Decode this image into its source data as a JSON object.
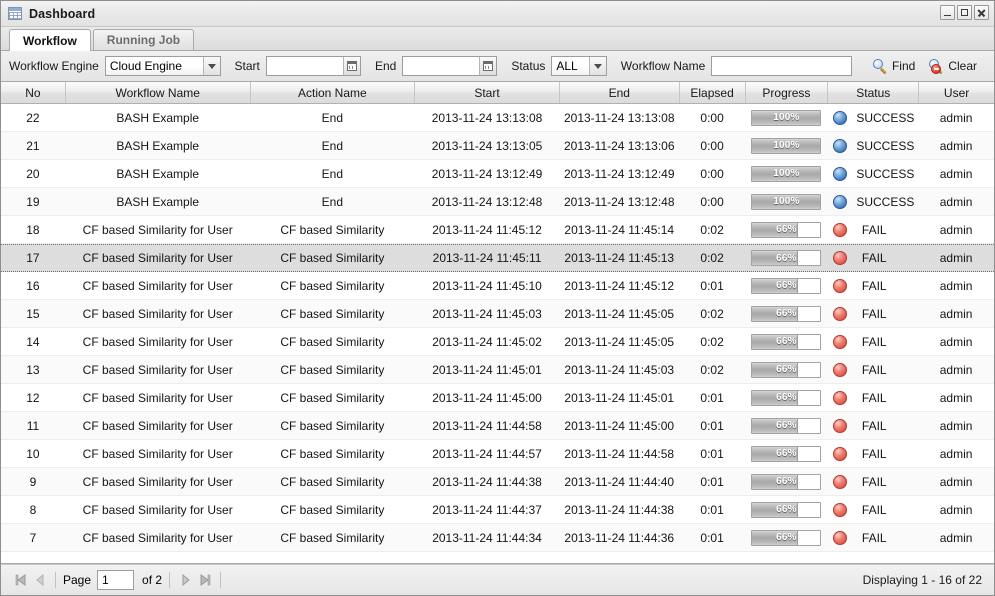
{
  "window": {
    "title": "Dashboard",
    "icon": "grid-icon",
    "controls": {
      "minimize": "minimize-icon",
      "maximize": "maximize-icon",
      "close": "close-icon"
    }
  },
  "tabs": [
    {
      "label": "Workflow",
      "active": true
    },
    {
      "label": "Running Job",
      "active": false
    }
  ],
  "filters": {
    "engine_label": "Workflow Engine",
    "engine_value": "Cloud Engine",
    "start_label": "Start",
    "start_value": "",
    "start_placeholder": "",
    "end_label": "End",
    "end_value": "",
    "end_placeholder": "",
    "status_label": "Status",
    "status_value": "ALL",
    "name_label": "Workflow Name",
    "name_value": "",
    "name_placeholder": "",
    "find_label": "Find",
    "clear_label": "Clear"
  },
  "grid": {
    "columns": [
      "No",
      "Workflow Name",
      "Action Name",
      "Start",
      "End",
      "Elapsed",
      "Progress",
      "Status",
      "User"
    ],
    "rows": [
      {
        "no": "22",
        "workflow": "BASH Example",
        "action": "End",
        "start": "2013-11-24 13:13:08",
        "end": "2013-11-24 13:13:08",
        "elapsed": "0:00",
        "progress": "100%",
        "progress_pct": 100,
        "status": "SUCCESS",
        "user": "admin",
        "selected": false
      },
      {
        "no": "21",
        "workflow": "BASH Example",
        "action": "End",
        "start": "2013-11-24 13:13:05",
        "end": "2013-11-24 13:13:06",
        "elapsed": "0:00",
        "progress": "100%",
        "progress_pct": 100,
        "status": "SUCCESS",
        "user": "admin",
        "selected": false
      },
      {
        "no": "20",
        "workflow": "BASH Example",
        "action": "End",
        "start": "2013-11-24 13:12:49",
        "end": "2013-11-24 13:12:49",
        "elapsed": "0:00",
        "progress": "100%",
        "progress_pct": 100,
        "status": "SUCCESS",
        "user": "admin",
        "selected": false
      },
      {
        "no": "19",
        "workflow": "BASH Example",
        "action": "End",
        "start": "2013-11-24 13:12:48",
        "end": "2013-11-24 13:12:48",
        "elapsed": "0:00",
        "progress": "100%",
        "progress_pct": 100,
        "status": "SUCCESS",
        "user": "admin",
        "selected": false
      },
      {
        "no": "18",
        "workflow": "CF based Similarity for User",
        "action": "CF based Similarity",
        "start": "2013-11-24 11:45:12",
        "end": "2013-11-24 11:45:14",
        "elapsed": "0:02",
        "progress": "66%",
        "progress_pct": 66,
        "status": "FAIL",
        "user": "admin",
        "selected": false
      },
      {
        "no": "17",
        "workflow": "CF based Similarity for User",
        "action": "CF based Similarity",
        "start": "2013-11-24 11:45:11",
        "end": "2013-11-24 11:45:13",
        "elapsed": "0:02",
        "progress": "66%",
        "progress_pct": 66,
        "status": "FAIL",
        "user": "admin",
        "selected": true
      },
      {
        "no": "16",
        "workflow": "CF based Similarity for User",
        "action": "CF based Similarity",
        "start": "2013-11-24 11:45:10",
        "end": "2013-11-24 11:45:12",
        "elapsed": "0:01",
        "progress": "66%",
        "progress_pct": 66,
        "status": "FAIL",
        "user": "admin",
        "selected": false
      },
      {
        "no": "15",
        "workflow": "CF based Similarity for User",
        "action": "CF based Similarity",
        "start": "2013-11-24 11:45:03",
        "end": "2013-11-24 11:45:05",
        "elapsed": "0:02",
        "progress": "66%",
        "progress_pct": 66,
        "status": "FAIL",
        "user": "admin",
        "selected": false
      },
      {
        "no": "14",
        "workflow": "CF based Similarity for User",
        "action": "CF based Similarity",
        "start": "2013-11-24 11:45:02",
        "end": "2013-11-24 11:45:05",
        "elapsed": "0:02",
        "progress": "66%",
        "progress_pct": 66,
        "status": "FAIL",
        "user": "admin",
        "selected": false
      },
      {
        "no": "13",
        "workflow": "CF based Similarity for User",
        "action": "CF based Similarity",
        "start": "2013-11-24 11:45:01",
        "end": "2013-11-24 11:45:03",
        "elapsed": "0:02",
        "progress": "66%",
        "progress_pct": 66,
        "status": "FAIL",
        "user": "admin",
        "selected": false
      },
      {
        "no": "12",
        "workflow": "CF based Similarity for User",
        "action": "CF based Similarity",
        "start": "2013-11-24 11:45:00",
        "end": "2013-11-24 11:45:01",
        "elapsed": "0:01",
        "progress": "66%",
        "progress_pct": 66,
        "status": "FAIL",
        "user": "admin",
        "selected": false
      },
      {
        "no": "11",
        "workflow": "CF based Similarity for User",
        "action": "CF based Similarity",
        "start": "2013-11-24 11:44:58",
        "end": "2013-11-24 11:45:00",
        "elapsed": "0:01",
        "progress": "66%",
        "progress_pct": 66,
        "status": "FAIL",
        "user": "admin",
        "selected": false
      },
      {
        "no": "10",
        "workflow": "CF based Similarity for User",
        "action": "CF based Similarity",
        "start": "2013-11-24 11:44:57",
        "end": "2013-11-24 11:44:58",
        "elapsed": "0:01",
        "progress": "66%",
        "progress_pct": 66,
        "status": "FAIL",
        "user": "admin",
        "selected": false
      },
      {
        "no": "9",
        "workflow": "CF based Similarity for User",
        "action": "CF based Similarity",
        "start": "2013-11-24 11:44:38",
        "end": "2013-11-24 11:44:40",
        "elapsed": "0:01",
        "progress": "66%",
        "progress_pct": 66,
        "status": "FAIL",
        "user": "admin",
        "selected": false
      },
      {
        "no": "8",
        "workflow": "CF based Similarity for User",
        "action": "CF based Similarity",
        "start": "2013-11-24 11:44:37",
        "end": "2013-11-24 11:44:38",
        "elapsed": "0:01",
        "progress": "66%",
        "progress_pct": 66,
        "status": "FAIL",
        "user": "admin",
        "selected": false
      },
      {
        "no": "7",
        "workflow": "CF based Similarity for User",
        "action": "CF based Similarity",
        "start": "2013-11-24 11:44:34",
        "end": "2013-11-24 11:44:36",
        "elapsed": "0:01",
        "progress": "66%",
        "progress_pct": 66,
        "status": "FAIL",
        "user": "admin",
        "selected": false
      }
    ]
  },
  "pagination": {
    "first_icon": "first-page-icon",
    "prev_icon": "prev-page-icon",
    "page_label": "Page",
    "page_value": "1",
    "of_label": "of 2",
    "next_icon": "next-page-icon",
    "last_icon": "last-page-icon",
    "displaying": "Displaying 1 - 16 of 22"
  },
  "colors": {
    "success": "#3f79bf",
    "fail": "#e0584a",
    "selected_row": "#dddddd"
  }
}
